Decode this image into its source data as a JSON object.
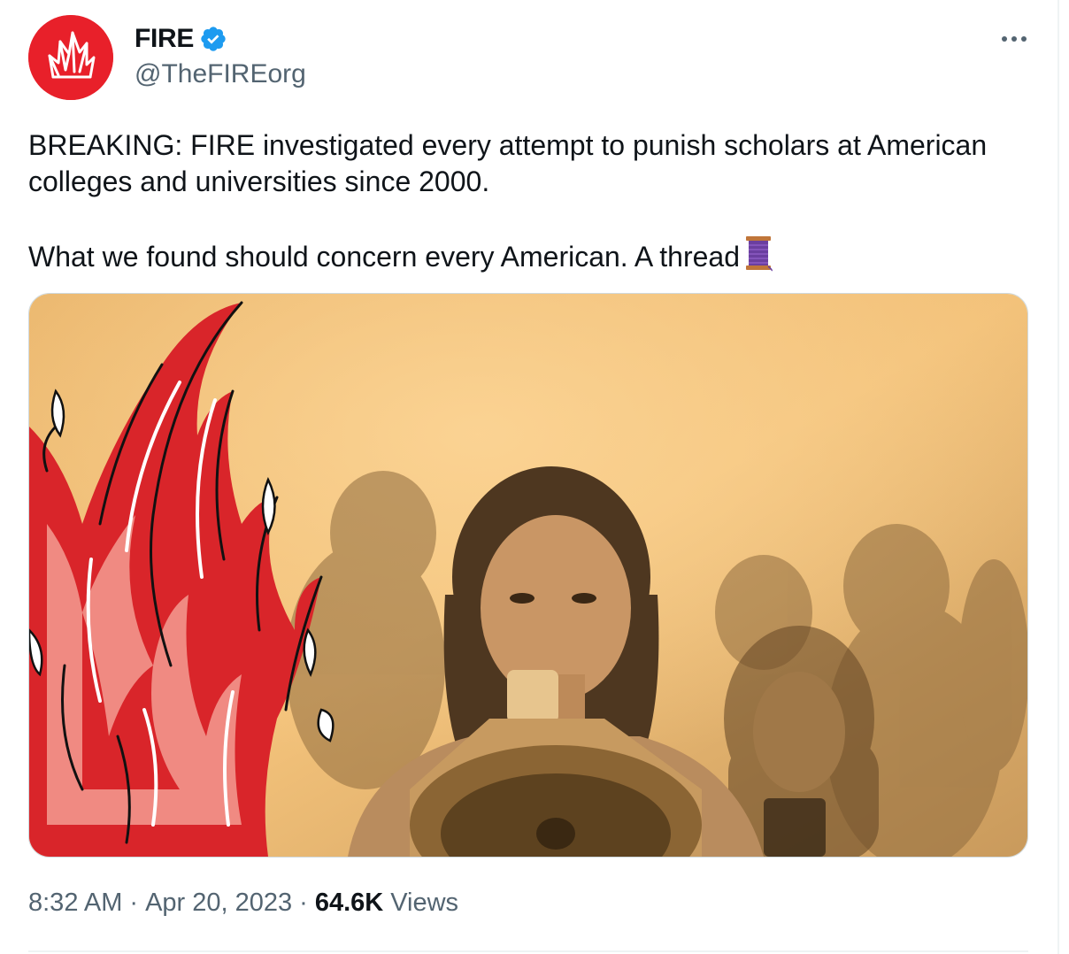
{
  "author": {
    "display_name": "FIRE",
    "handle": "@TheFIREorg",
    "avatar_icon": "fire-logo-icon",
    "verified_icon": "verified-badge-icon",
    "brand_color": "#e8202a",
    "verified_color": "#1d9bf0"
  },
  "menu": {
    "more_icon": "more-dots-icon"
  },
  "tweet": {
    "line1": "BREAKING: FIRE investigated every attempt to punish scholars at American colleges and universities since 2000.",
    "line2": "What we found should concern every American. A thread",
    "thread_emoji": "🧵"
  },
  "media": {
    "image_type": "photo-with-fire-illustration",
    "tint_color": "#f7c06b",
    "flame_color": "#d9252a"
  },
  "meta": {
    "time": "8:32 AM",
    "date": "Apr 20, 2023",
    "separator": "·",
    "views_count": "64.6K",
    "views_label": "Views"
  }
}
